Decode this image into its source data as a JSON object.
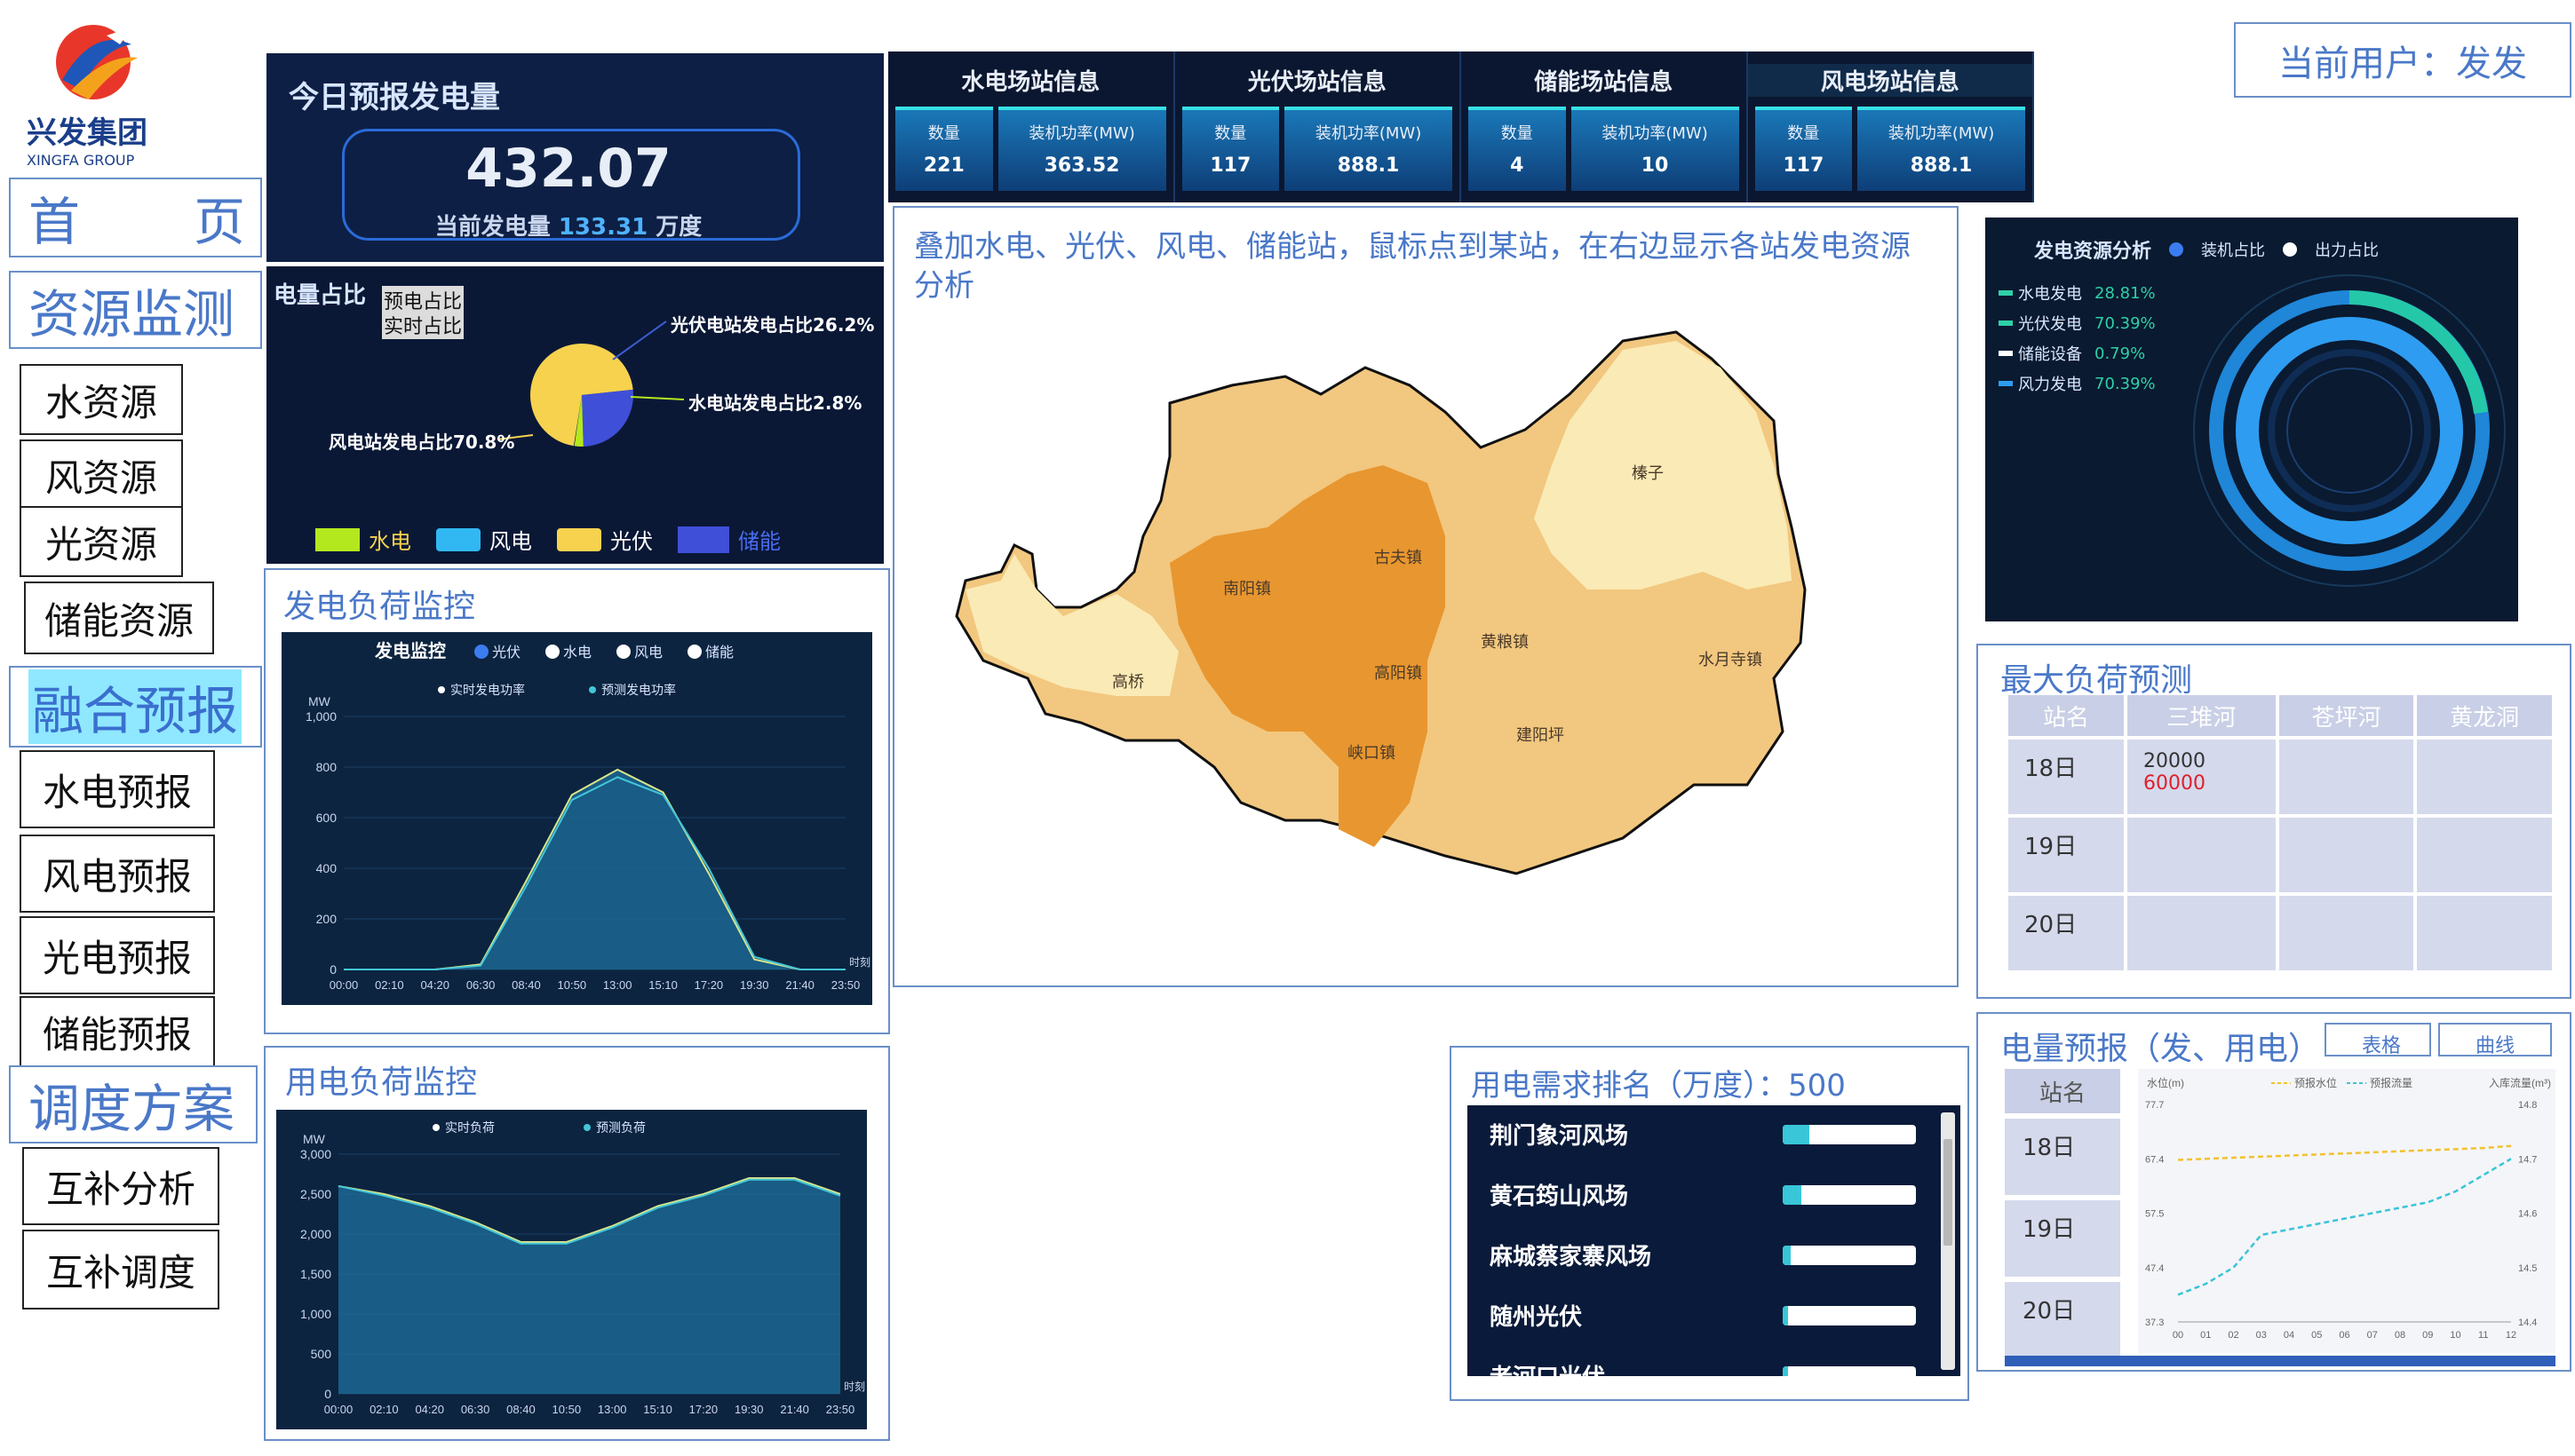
{
  "brand": {
    "name_cn": "兴发集团",
    "name_en": "XINGFA GROUP"
  },
  "user": {
    "label": "当前用户：发发"
  },
  "nav": {
    "home": "首　　页",
    "resource_monitor": "资源监测",
    "resource_items": [
      "水资源",
      "风资源",
      "光资源",
      "储能资源"
    ],
    "fusion_forecast": "融合预报",
    "forecast_items": [
      "水电预报",
      "风电预报",
      "光电预报",
      "储能预报"
    ],
    "dispatch_plan": "调度方案",
    "dispatch_items": [
      "互补分析",
      "互补调度"
    ]
  },
  "today_forecast": {
    "title": "今日预报发电量",
    "value": "432.07",
    "current_label": "当前发电量",
    "current_value": "133.31",
    "current_unit": "万度"
  },
  "pie_panel": {
    "title": "电量占比",
    "toggle_forecast": "预电占比",
    "toggle_actual": "实时占比",
    "label_pv": "光伏电站发电占比26.2%",
    "label_hydro": "水电站发电占比2.8%",
    "label_wind": "风电站发电占比70.8%",
    "legend": [
      "水电",
      "风电",
      "光伏",
      "储能"
    ],
    "colors": {
      "hydro": "#b4e81e",
      "wind": "#31b8f2",
      "pv": "#f6d24e",
      "storage": "#3f4fd8"
    }
  },
  "stations": [
    {
      "title": "水电场站信息",
      "count_label": "数量",
      "cap_label": "装机功率(MW)",
      "count": "221",
      "cap": "363.52"
    },
    {
      "title": "光伏场站信息",
      "count_label": "数量",
      "cap_label": "装机功率(MW)",
      "count": "117",
      "cap": "888.1"
    },
    {
      "title": "储能场站信息",
      "count_label": "数量",
      "cap_label": "装机功率(MW)",
      "count": "4",
      "cap": "10"
    },
    {
      "title": "风电场站信息",
      "count_label": "数量",
      "cap_label": "装机功率(MW)",
      "count": "117",
      "cap": "888.1"
    }
  ],
  "map_panel": {
    "note": "叠加水电、光伏、风电、储能站，鼠标点到某站，在右边显示各站发电资源分析",
    "places": [
      "榛子",
      "古夫镇",
      "南阳镇",
      "黄粮镇",
      "水月寺镇",
      "高桥",
      "高阳镇",
      "建阳坪",
      "峡口镇"
    ]
  },
  "gen_analysis": {
    "title": "发电资源分析",
    "legend_a": "装机占比",
    "legend_b": "出力占比",
    "rows": [
      {
        "label": "水电发电",
        "value": "28.81%"
      },
      {
        "label": "光伏发电",
        "value": "70.39%"
      },
      {
        "label": "储能设备",
        "value": "0.79%"
      },
      {
        "label": "风力发电",
        "value": "70.39%"
      }
    ]
  },
  "gen_load": {
    "title": "发电负荷监控",
    "chart_title": "发电监控",
    "legend_types": [
      "光伏",
      "水电",
      "风电",
      "储能"
    ],
    "series_names": [
      "实时发电功率",
      "预测发电功率"
    ],
    "unit": "MW",
    "side_label": "时刻"
  },
  "use_load": {
    "title": "用电负荷监控",
    "series_names": [
      "实时负荷",
      "预测负荷"
    ],
    "unit": "MW",
    "side_label": "时刻"
  },
  "chart_data": [
    {
      "type": "area",
      "title": "发电监控",
      "ylabel": "MW",
      "x": [
        "00:00",
        "02:10",
        "04:20",
        "06:30",
        "08:40",
        "10:50",
        "13:00",
        "15:10",
        "17:20",
        "19:30",
        "21:40",
        "23:50"
      ],
      "ylim": [
        0,
        1000
      ],
      "yticks": [
        "0",
        "200",
        "400",
        "600",
        "800",
        "1,000"
      ],
      "series": [
        {
          "name": "实时发电功率",
          "values": [
            0,
            0,
            0,
            20,
            350,
            690,
            790,
            700,
            380,
            40,
            0,
            0
          ]
        },
        {
          "name": "预测发电功率",
          "values": [
            0,
            0,
            0,
            15,
            330,
            670,
            760,
            690,
            400,
            50,
            0,
            0
          ]
        }
      ]
    },
    {
      "type": "area",
      "title": "",
      "ylabel": "MW",
      "x": [
        "00:00",
        "02:10",
        "04:20",
        "06:30",
        "08:40",
        "10:50",
        "13:00",
        "15:10",
        "17:20",
        "19:30",
        "21:40",
        "23:50"
      ],
      "ylim": [
        0,
        3000
      ],
      "yticks": [
        "0",
        "500",
        "1,000",
        "1,500",
        "2,000",
        "2,500",
        "3,000"
      ],
      "series": [
        {
          "name": "实时负荷",
          "values": [
            2600,
            2500,
            2350,
            2150,
            1900,
            1900,
            2100,
            2350,
            2500,
            2700,
            2700,
            2500
          ]
        },
        {
          "name": "预测负荷",
          "values": [
            2600,
            2480,
            2330,
            2130,
            1880,
            1880,
            2080,
            2330,
            2480,
            2680,
            2680,
            2480
          ]
        }
      ]
    },
    {
      "type": "line",
      "title": "",
      "x": [
        "00",
        "01",
        "02",
        "03",
        "04",
        "05",
        "06",
        "07",
        "08",
        "09",
        "10",
        "11",
        "12"
      ],
      "series": [
        {
          "name": "预报水位",
          "values": [
            67.4,
            67.6,
            67.8,
            68.0,
            68.2,
            68.4,
            68.6,
            68.8,
            69.0,
            69.2,
            69.4,
            69.6,
            70.0
          ]
        },
        {
          "name": "预报流量",
          "values": [
            14.45,
            14.47,
            14.5,
            14.56,
            14.57,
            14.58,
            14.59,
            14.6,
            14.61,
            14.62,
            14.64,
            14.67,
            14.7
          ]
        }
      ],
      "ylabel_left": "水位(m)",
      "ylabel_right": "入库流量(m³)",
      "yticks_left": [
        "37.3",
        "47.4",
        "57.5",
        "67.4",
        "77.7"
      ],
      "yticks_right": [
        "14.4",
        "14.5",
        "14.6",
        "14.7",
        "14.8"
      ]
    }
  ],
  "max_load": {
    "title": "最大负荷预测",
    "headers": [
      "站名",
      "三堆河",
      "苍坪河",
      "黄龙洞"
    ],
    "rows": [
      {
        "day": "18日",
        "v1": "20000",
        "v2": "60000"
      },
      {
        "day": "19日"
      },
      {
        "day": "20日"
      }
    ]
  },
  "demand_rank": {
    "title": "用电需求排名（万度）：500",
    "items": [
      "荆门象河风场",
      "黄石筠山风场",
      "麻城蔡家寨风场",
      "随州光伏",
      "老河口光伏"
    ]
  },
  "energy_forecast": {
    "title": "电量预报（发、用电）",
    "tab_table": "表格",
    "tab_curve": "曲线",
    "header": "站名",
    "days": [
      "18日",
      "19日",
      "20日"
    ]
  }
}
